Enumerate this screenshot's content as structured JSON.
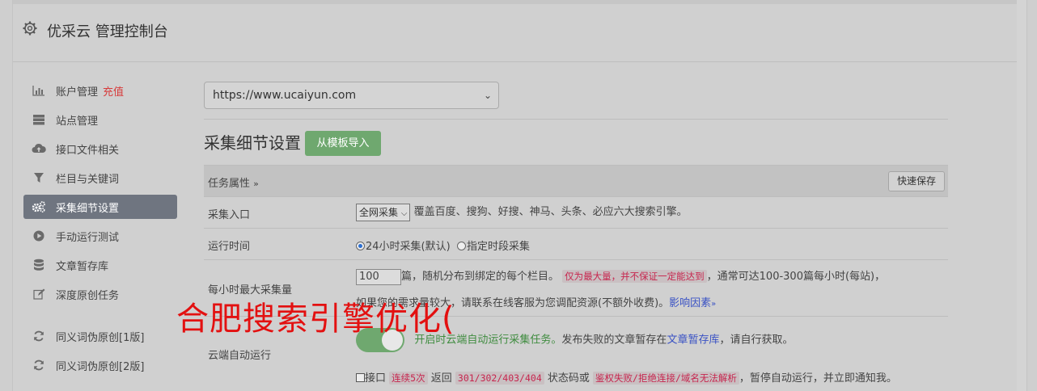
{
  "header": {
    "title": "优采云 管理控制台",
    "icon": "gear-icon"
  },
  "sidebar": {
    "items": [
      {
        "label": "账户管理",
        "extra": "充值",
        "icon": "bar-chart-icon"
      },
      {
        "label": "站点管理",
        "icon": "server-icon"
      },
      {
        "label": "接口文件相关",
        "icon": "cloud-upload-icon"
      },
      {
        "label": "栏目与关键词",
        "icon": "filter-icon"
      },
      {
        "label": "采集细节设置",
        "icon": "gears-icon",
        "active": true
      },
      {
        "label": "手动运行测试",
        "icon": "play-circle-icon"
      },
      {
        "label": "文章暂存库",
        "icon": "database-icon"
      },
      {
        "label": "深度原创任务",
        "icon": "edit-icon"
      },
      {
        "label": "同义词伪原创[1版]",
        "icon": "refresh-icon"
      },
      {
        "label": "同义词伪原创[2版]",
        "icon": "refresh-icon"
      }
    ]
  },
  "main": {
    "site_select": "https://www.ucaiyun.com",
    "section_title": "采集细节设置",
    "import_button": "从模板导入",
    "table": {
      "task_attr": "任务属性",
      "quick_save": "快速保存",
      "entry": {
        "label": "采集入口",
        "select": "全网采集",
        "desc": "覆盖百度、搜狗、好搜、神马、头条、必应六大搜索引擎。"
      },
      "runtime": {
        "label": "运行时间",
        "opt1": "24小时采集(默认)",
        "opt2": "指定时段采集"
      },
      "max_per_hour": {
        "label": "每小时最大采集量",
        "value": "100",
        "text1": "篇，随机分布到绑定的每个栏目。",
        "code1": "仅为最大量，并不保证一定能达到",
        "text2": "，通常可达100-300篇每小时(每站)，",
        "text3": "如果您的需求量较大，请联系在线客服为您调配资源(不额外收费)。",
        "link": "影响因素"
      },
      "cloud_auto": {
        "label": "云端自动运行",
        "on_text": "开启时云端自动运行采集任务。",
        "text1": "发布失败的文章暂存在",
        "link": "文章暂存库",
        "text2": "，请自行获取。",
        "chk_label": "接口",
        "code1": "连续5次",
        "text3": "返回",
        "code2": "301/302/403/404",
        "text4": "状态码或",
        "code3": "鉴权失败/拒绝连接/域名无法解析",
        "text5": "，暂停自动运行，并立即通知我。"
      }
    }
  },
  "watermark": "合肥搜索引擎优化(",
  "colors": {
    "accent_green": "#6fa86f",
    "active_item": "#6f7580",
    "red": "#d73b3b",
    "link": "#3a52c4"
  }
}
